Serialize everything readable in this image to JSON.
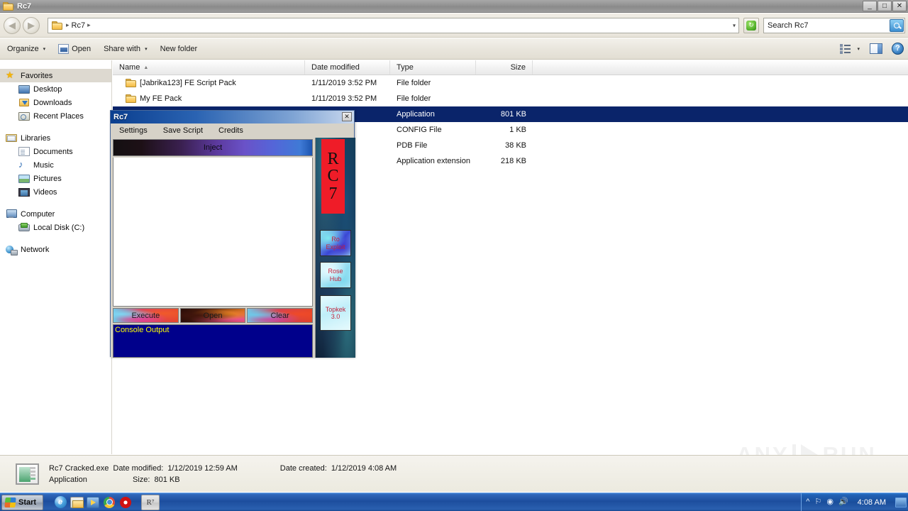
{
  "window": {
    "title": "Rc7",
    "icon": "folder-icon",
    "buttons": {
      "minimize": "_",
      "maximize": "□",
      "close": "✕"
    }
  },
  "address_bar": {
    "back": "◀",
    "forward": "▶",
    "breadcrumb_folder_icon": "folder-icon",
    "breadcrumb": "Rc7",
    "sep_left": "▸",
    "sep_right": "▸",
    "dropdown": "▾",
    "refresh_icon": "refresh-icon",
    "search": {
      "placeholder": "Search Rc7",
      "icon": "search-icon"
    }
  },
  "command_bar": {
    "organize": "Organize",
    "open": "Open",
    "share_with": "Share with",
    "new_folder": "New folder",
    "caret": "▾",
    "view_icon": "view-list-icon",
    "view_caret": "▾",
    "preview_pane_icon": "preview-pane-icon",
    "help_icon": "?"
  },
  "sidebar": {
    "groups": [
      {
        "header": {
          "label": "Favorites",
          "icon": "star-icon",
          "selected": true
        },
        "items": [
          {
            "label": "Desktop",
            "icon": "desktop-icon"
          },
          {
            "label": "Downloads",
            "icon": "downloads-icon"
          },
          {
            "label": "Recent Places",
            "icon": "recent-places-icon"
          }
        ]
      },
      {
        "header": {
          "label": "Libraries",
          "icon": "libraries-icon",
          "selected": false
        },
        "items": [
          {
            "label": "Documents",
            "icon": "documents-icon"
          },
          {
            "label": "Music",
            "icon": "music-icon"
          },
          {
            "label": "Pictures",
            "icon": "pictures-icon"
          },
          {
            "label": "Videos",
            "icon": "videos-icon"
          }
        ]
      },
      {
        "header": {
          "label": "Computer",
          "icon": "computer-icon",
          "selected": false
        },
        "items": [
          {
            "label": "Local Disk (C:)",
            "icon": "local-disk-icon"
          }
        ]
      },
      {
        "header": {
          "label": "Network",
          "icon": "network-icon",
          "selected": false
        },
        "items": []
      }
    ]
  },
  "file_list": {
    "columns": {
      "name": "Name",
      "date_modified": "Date modified",
      "type": "Type",
      "size": "Size",
      "sort_arrow": "▲"
    },
    "rows": [
      {
        "name": "[Jabrika123] FE Script Pack",
        "date": "1/11/2019 3:52 PM",
        "type": "File folder",
        "size": "",
        "icon": "folder-icon",
        "selected": false
      },
      {
        "name": "My FE Pack",
        "date": "1/11/2019 3:52 PM",
        "type": "File folder",
        "size": "",
        "icon": "folder-icon",
        "selected": false
      },
      {
        "name": "",
        "date": ":59 AM",
        "type": "Application",
        "size": "801 KB",
        "icon": "",
        "selected": true
      },
      {
        "name": "",
        "date": "18 PM",
        "type": "CONFIG File",
        "size": "1 KB",
        "icon": "",
        "selected": false
      },
      {
        "name": "",
        "date": ":59 AM",
        "type": "PDB File",
        "size": "38 KB",
        "icon": "",
        "selected": false
      },
      {
        "name": "",
        "date": "1 AM",
        "type": "Application extension",
        "size": "218 KB",
        "icon": "",
        "selected": false
      }
    ]
  },
  "rc7_app": {
    "title": "Rc7",
    "close": "✕",
    "menu": [
      "Settings",
      "Save Script",
      "Credits"
    ],
    "inject_label": "Inject",
    "script_text": "",
    "actions": [
      "Execute",
      "Open",
      "Clear"
    ],
    "console_label": "Console Output",
    "logo": {
      "line1": "R",
      "line2": "C",
      "line3": "7"
    },
    "side_buttons": [
      {
        "line1": "Ro",
        "line2": "Exploit"
      },
      {
        "line1": "Rose",
        "line2": "Hub"
      },
      {
        "line1": "Topkek",
        "line2": "3.0"
      }
    ]
  },
  "details_pane": {
    "file_name": "Rc7 Cracked.exe",
    "date_modified_label": "Date modified:",
    "date_modified_value": "1/12/2019 12:59 AM",
    "date_created_label": "Date created:",
    "date_created_value": "1/12/2019 4:08 AM",
    "kind": "Application",
    "size_label": "Size:",
    "size_value": "801 KB",
    "icon": "application-icon"
  },
  "watermark": {
    "left": "ANY",
    "right": "RUN"
  },
  "taskbar": {
    "start": "Start",
    "quick_launch": [
      "internet-explorer-icon",
      "explorer-icon",
      "media-player-icon",
      "chrome-icon",
      "opera-icon"
    ],
    "task_button": "R⁷",
    "tray_icons": [
      "show-hidden-icons",
      "action-center-flag-icon",
      "network-icon",
      "volume-icon"
    ],
    "clock": "4:08 AM",
    "show_desktop": "show-desktop-button"
  }
}
